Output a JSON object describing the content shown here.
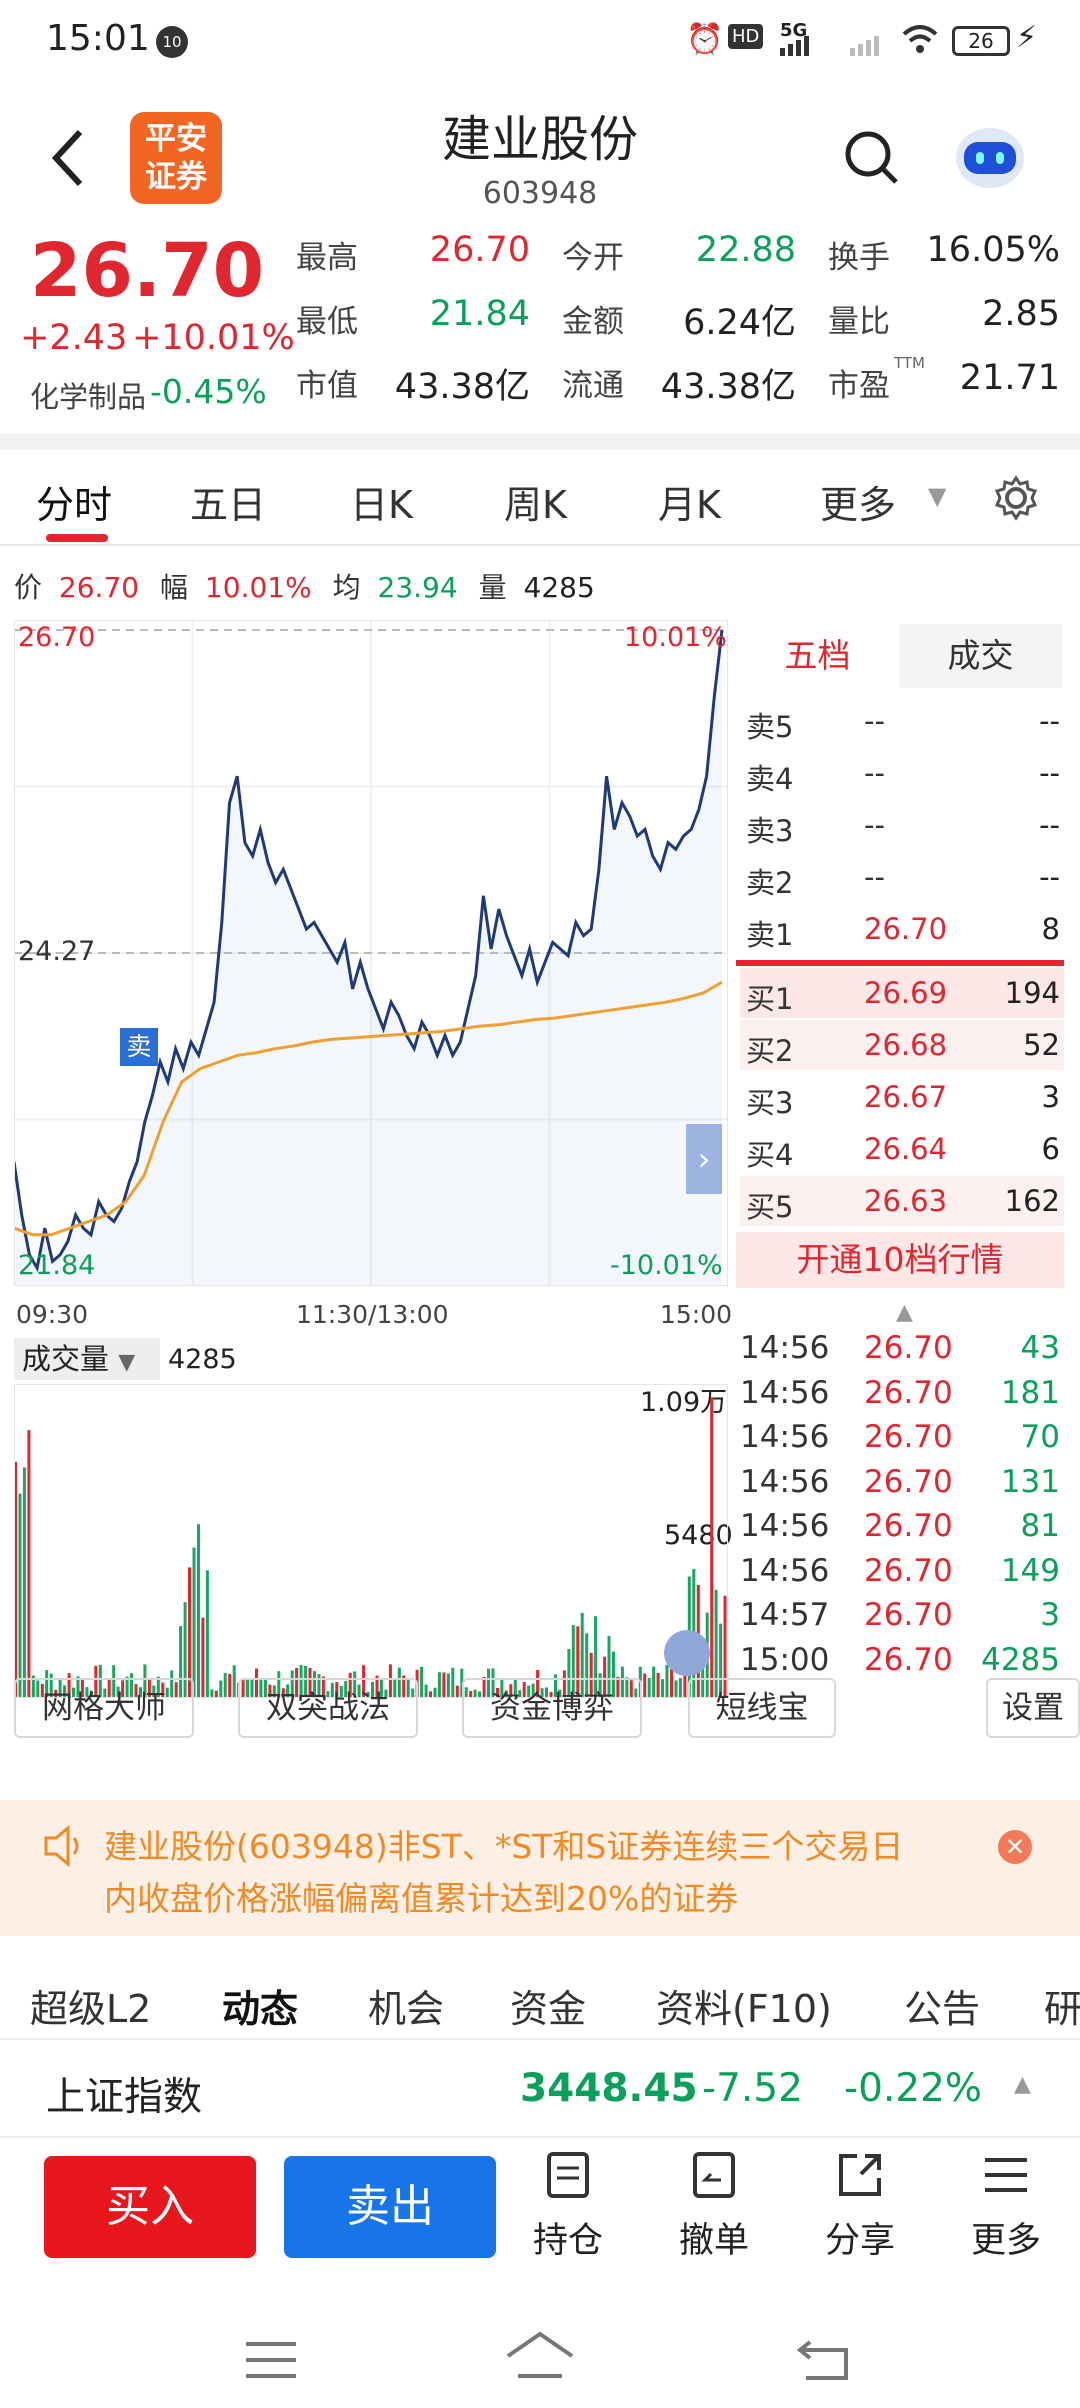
{
  "status_bar": {
    "time": "15:01",
    "notif_badge": "10",
    "hd_label": "HD",
    "network": "5G",
    "battery": "26"
  },
  "header": {
    "broker_logo": "平安\n证券",
    "title": "建业股份",
    "code": "603948"
  },
  "quote": {
    "price": "26.70",
    "change": "+2.43",
    "change_pct": "+10.01%",
    "sector_name": "化学制品",
    "sector_pct": "-0.45%",
    "fields": [
      [
        {
          "label": "最高",
          "value": "26.70",
          "color": "red"
        },
        {
          "label": "今开",
          "value": "22.88",
          "color": "green"
        },
        {
          "label": "换手",
          "value": "16.05%",
          "color": "dark"
        }
      ],
      [
        {
          "label": "最低",
          "value": "21.84",
          "color": "green"
        },
        {
          "label": "金额",
          "value": "6.24亿",
          "color": "dark"
        },
        {
          "label": "量比",
          "value": "2.85",
          "color": "dark"
        }
      ],
      [
        {
          "label": "市值",
          "value": "43.38亿",
          "color": "dark"
        },
        {
          "label": "流通",
          "value": "43.38亿",
          "color": "dark"
        },
        {
          "label": "市盈",
          "value": "21.71",
          "color": "dark",
          "sup": "TTM"
        }
      ]
    ]
  },
  "tabs": {
    "items": [
      "分时",
      "五日",
      "日K",
      "周K",
      "月K",
      "更多"
    ],
    "active": "分时"
  },
  "info_line": {
    "price_label": "价",
    "price": "26.70",
    "amp_label": "幅",
    "amp": "10.01%",
    "avg_label": "均",
    "avg": "23.94",
    "vol_label": "量",
    "vol": "4285"
  },
  "chart_data": {
    "type": "line",
    "y_high": "26.70",
    "y_mid": "24.27",
    "y_low": "21.84",
    "pct_high": "10.01%",
    "pct_low": "-10.01%",
    "x_labels": [
      "09:30",
      "11:30/13:00",
      "15:00"
    ],
    "sell_marker": "卖",
    "series": [
      {
        "name": "价",
        "values": [
          22.7,
          22.3,
          22.0,
          21.9,
          22.2,
          21.95,
          22.0,
          22.1,
          22.3,
          22.2,
          22.15,
          22.4,
          22.3,
          22.25,
          22.35,
          22.55,
          22.7,
          23.0,
          23.2,
          23.45,
          23.3,
          23.55,
          23.4,
          23.6,
          23.5,
          23.7,
          23.9,
          24.5,
          25.4,
          25.6,
          25.1,
          25.0,
          25.2,
          24.95,
          24.8,
          24.9,
          24.75,
          24.6,
          24.45,
          24.5,
          24.4,
          24.3,
          24.2,
          24.35,
          24.0,
          24.2,
          24.0,
          23.85,
          23.7,
          23.9,
          23.8,
          23.65,
          23.55,
          23.75,
          23.65,
          23.5,
          23.65,
          23.5,
          23.6,
          23.85,
          24.1,
          24.7,
          24.3,
          24.6,
          24.4,
          24.25,
          24.1,
          24.3,
          24.05,
          24.2,
          24.35,
          24.3,
          24.25,
          24.5,
          24.4,
          24.45,
          24.9,
          25.6,
          25.2,
          25.4,
          25.3,
          25.15,
          25.2,
          25.0,
          24.9,
          25.1,
          25.05,
          25.15,
          25.2,
          25.35,
          25.6,
          26.2,
          26.7
        ],
        "color": "#1f3a7a"
      },
      {
        "name": "均",
        "values": [
          22.2,
          22.15,
          22.15,
          22.2,
          22.25,
          22.3,
          22.4,
          22.6,
          23.0,
          23.3,
          23.4,
          23.45,
          23.5,
          23.52,
          23.55,
          23.57,
          23.6,
          23.62,
          23.63,
          23.64,
          23.65,
          23.66,
          23.67,
          23.68,
          23.7,
          23.72,
          23.73,
          23.75,
          23.77,
          23.78,
          23.8,
          23.82,
          23.84,
          23.86,
          23.88,
          23.9,
          23.93,
          23.97,
          24.05
        ],
        "color": "#f0a030"
      }
    ]
  },
  "orderbook": {
    "tabs": [
      "五档",
      "成交"
    ],
    "asks": [
      {
        "label": "卖5",
        "price": "--",
        "vol": "--"
      },
      {
        "label": "卖4",
        "price": "--",
        "vol": "--"
      },
      {
        "label": "卖3",
        "price": "--",
        "vol": "--"
      },
      {
        "label": "卖2",
        "price": "--",
        "vol": "--"
      },
      {
        "label": "卖1",
        "price": "26.70",
        "vol": "8"
      }
    ],
    "bids": [
      {
        "label": "买1",
        "price": "26.69",
        "vol": "194"
      },
      {
        "label": "买2",
        "price": "26.68",
        "vol": "52"
      },
      {
        "label": "买3",
        "price": "26.67",
        "vol": "3"
      },
      {
        "label": "买4",
        "price": "26.64",
        "vol": "6"
      },
      {
        "label": "买5",
        "price": "26.63",
        "vol": "162"
      }
    ],
    "cta": "开通10档行情"
  },
  "volume_panel": {
    "label": "成交量",
    "value": "4285",
    "max_label": "1.09万",
    "mid_label": "5480"
  },
  "trades": [
    {
      "time": "14:56",
      "price": "26.70",
      "vol": "43"
    },
    {
      "time": "14:56",
      "price": "26.70",
      "vol": "181"
    },
    {
      "time": "14:56",
      "price": "26.70",
      "vol": "70"
    },
    {
      "time": "14:56",
      "price": "26.70",
      "vol": "131"
    },
    {
      "time": "14:56",
      "price": "26.70",
      "vol": "81"
    },
    {
      "time": "14:56",
      "price": "26.70",
      "vol": "149"
    },
    {
      "time": "14:57",
      "price": "26.70",
      "vol": "3"
    },
    {
      "time": "15:00",
      "price": "26.70",
      "vol": "4285"
    }
  ],
  "tools": {
    "items": [
      "网格大师",
      "双突战法",
      "资金博弈",
      "短线宝"
    ],
    "settings": "设置"
  },
  "notice": {
    "line1": "建业股份(603948)非ST、*ST和S证券连续三个交易日",
    "line2": "内收盘价格涨幅偏离值累计达到20%的证券"
  },
  "subtabs": {
    "items": [
      "超级L2",
      "动态",
      "机会",
      "资金",
      "资料(F10)",
      "公告",
      "研"
    ],
    "active": "动态"
  },
  "index_bar": {
    "name": "上证指数",
    "value": "3448.45",
    "change": "-7.52",
    "pct": "-0.22%"
  },
  "bottom_bar": {
    "buy": "买入",
    "sell": "卖出",
    "items": [
      "持仓",
      "撤单",
      "分享",
      "更多"
    ]
  }
}
